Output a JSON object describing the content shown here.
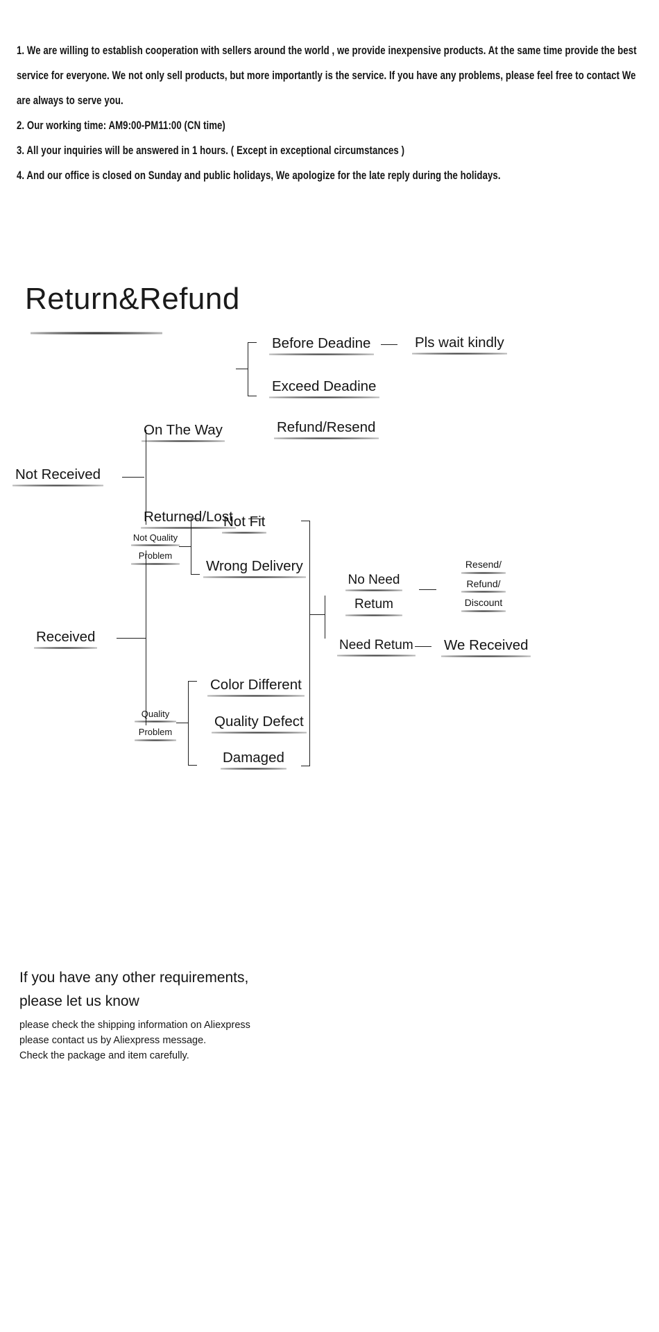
{
  "policy": {
    "lines": [
      "1. We are willing to establish cooperation with sellers around the world , we provide inexpensive products. At the same time provide the best",
      "service for everyone. We not only sell products, but more importantly is the service. If you have any problems, please feel free to contact We",
      "are always to serve you.",
      "2. Our working time: AM9:00-PM11:00 (CN time)",
      "3. All your inquiries will be answered in 1 hours. ( Except in exceptional circumstances )",
      "4. And our office is closed on Sunday and public holidays, We apologize for the late reply during the holidays."
    ]
  },
  "heading": {
    "title": "Return&Refund"
  },
  "flow_not_received": {
    "root": "Not    Received",
    "branch_on_the_way": "On The Way",
    "branch_returned_lost": "Returned/Lost",
    "before_deadline": "Before Deadine",
    "exceed_deadline": "Exceed Deadine",
    "pls_wait": "Pls wait kindly",
    "refund_resend": "Refund/Resend"
  },
  "flow_received": {
    "root": "Received",
    "not_quality_problem": [
      "Not Quality",
      "Problem"
    ],
    "quality_problem": [
      "Quality",
      "Problem"
    ],
    "not_fit": "Not Fit",
    "wrong_delivery": "Wrong Delivery",
    "color_different": "Color Different",
    "quality_defect": "Quality Defect",
    "damaged": "Damaged",
    "no_need_return": [
      "No Need",
      "Retum"
    ],
    "need_return": "Need Retum",
    "we_received": "We Received",
    "resend_refund_discount": [
      "Resend/",
      "Refund/",
      "Discount"
    ]
  },
  "footer": {
    "headline": [
      "If you have any other requirements,",
      " please let us know"
    ],
    "notes": [
      "please check the shipping information on Aliexpress",
      "please contact us by Aliexpress message.",
      "Check the package and item carefully."
    ]
  },
  "colors": {
    "ink": "#141414",
    "line": "#1f1f1f",
    "background": "#ffffff"
  }
}
